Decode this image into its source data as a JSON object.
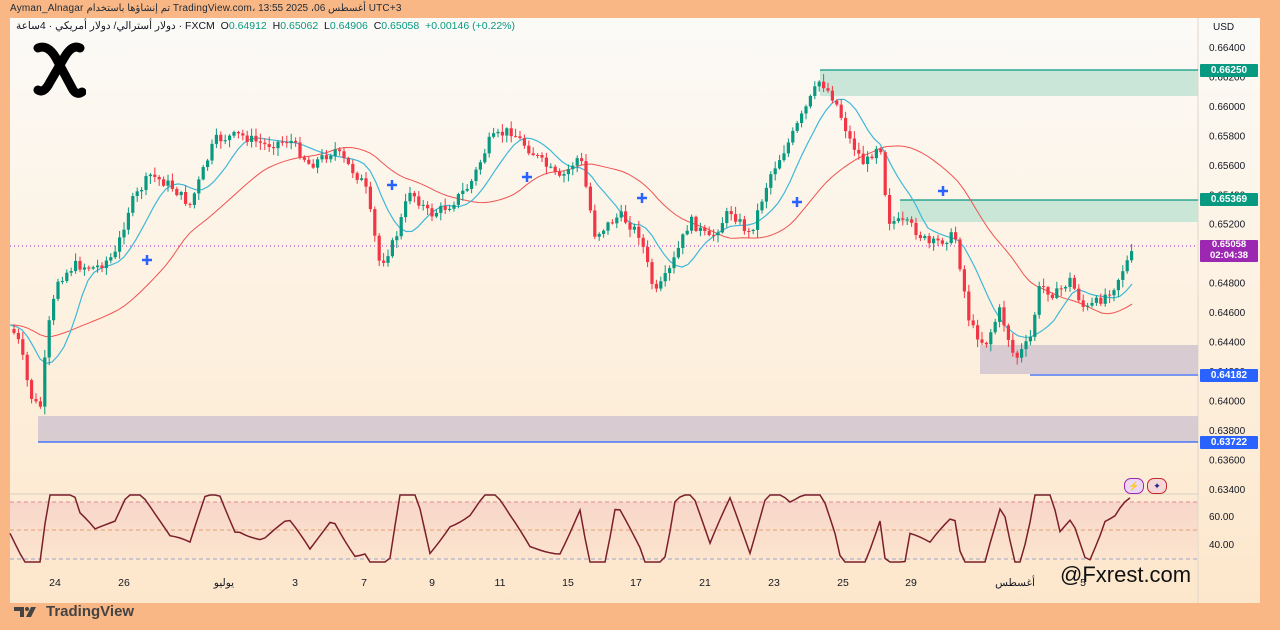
{
  "watermark": {
    "text": "Ayman_Alnagar تم إنشاؤها باستخدام TradingView.com، 13:55 2025 ،06 أغسطس UTC+3"
  },
  "header": {
    "symbol_desc": "دولار أسترالي/ دولار أمريكي · 4ساعة · FXCM",
    "open_label": "O",
    "open": "0.64912",
    "high_label": "H",
    "high": "0.65062",
    "low_label": "L",
    "low": "0.64906",
    "close_label": "C",
    "close": "0.65058",
    "change": "+0.00146 (+0.22%)"
  },
  "currency": "USD",
  "price_axis": [
    "0.66400",
    "0.66200",
    "0.66000",
    "0.65800",
    "0.65600",
    "0.65400",
    "0.65200",
    "0.65000",
    "0.64800",
    "0.64600",
    "0.64400",
    "0.64200",
    "0.64000",
    "0.63800",
    "0.63600",
    "0.63400"
  ],
  "price_tags": {
    "resistance_top": "0.66250",
    "resistance_mid": "0.65369",
    "current_price": "0.65058",
    "countdown": "02:04:38",
    "support_mid": "0.64182",
    "support_low": "0.63722"
  },
  "rsi_axis": [
    "60.00",
    "40.00"
  ],
  "time_axis": [
    "24",
    "26",
    "يوليو",
    "3",
    "7",
    "9",
    "11",
    "15",
    "17",
    "21",
    "23",
    "25",
    "29",
    "أغسطس",
    "5"
  ],
  "branding": {
    "tradingview": "TradingView",
    "handle": "@Fxrest.com"
  },
  "colors": {
    "up": "#089981",
    "down": "#f23645",
    "ma_fast": "#3fb8d8",
    "ma_slow": "#ef5350",
    "rsi": "#7b1f2b",
    "zone_green": "#bfe3d3",
    "zone_grey": "#d4c8d0"
  },
  "icons": [
    "logo-x-icon",
    "lightning-icon",
    "flag-au-icon",
    "tradingview-logo-icon"
  ]
}
